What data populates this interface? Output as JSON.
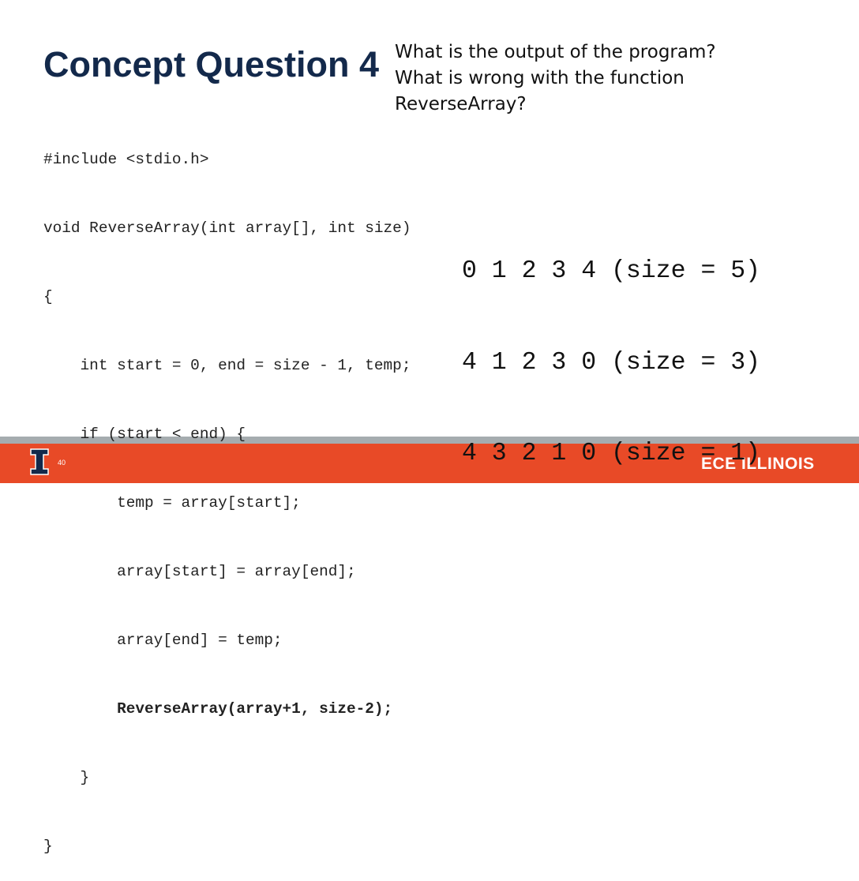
{
  "slide": {
    "title": "Concept Question 4",
    "questions": [
      "What is the output of the program?",
      "What is wrong with the function",
      "ReverseArray?"
    ],
    "code": [
      "#include <stdio.h>",
      "void ReverseArray(int array[], int size)",
      "{",
      "    int start = 0, end = size - 1, temp;",
      "    if (start < end) {",
      "        temp = array[start];",
      "        array[start] = array[end];",
      "        array[end] = temp;",
      "        ReverseArray(array+1, size-2);",
      "    }",
      "}"
    ],
    "outputs": [
      "0 1 2 3 4 (size = 5)",
      "4 1 2 3 0 (size = 3)",
      "4 3 2 1 0 (size = 1)"
    ]
  },
  "footer": {
    "page_number": "40",
    "brand": "ECE ILLINOIS",
    "logo_icon": "illinois-block-i-icon",
    "colors": {
      "orange": "#e84a27",
      "navy": "#13294b",
      "gray": "#a5acaf"
    }
  }
}
